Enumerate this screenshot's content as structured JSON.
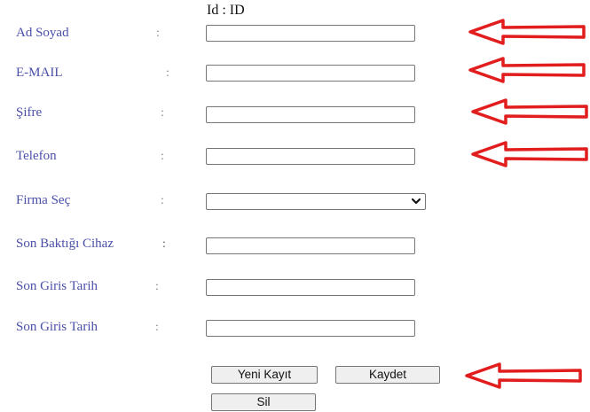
{
  "form": {
    "id_line": "Id : ID",
    "fields": [
      {
        "label": "Ad Soyad",
        "colon": ":",
        "value": ""
      },
      {
        "label": "E-MAIL",
        "colon": ":",
        "value": ""
      },
      {
        "label": "Şifre",
        "colon": ":",
        "value": ""
      },
      {
        "label": "Telefon",
        "colon": ":",
        "value": ""
      },
      {
        "label": "Firma Seç",
        "colon": ":",
        "value": ""
      },
      {
        "label": "Son Baktığı Cihaz",
        "colon": ":",
        "value": ""
      },
      {
        "label": "Son Giris Tarih",
        "colon": ":",
        "value": ""
      },
      {
        "label": "Son Giris Tarih",
        "colon": ":",
        "value": ""
      }
    ],
    "buttons": {
      "new_record": "Yeni Kayıt",
      "save": "Kaydet",
      "delete": "Sil"
    }
  },
  "colors": {
    "label": "#4a4fa8",
    "arrow": "#e11d1d",
    "button_bg": "#efefef"
  },
  "icons": {
    "select_chevron": "chevron-down-icon",
    "annotation_arrow": "left-arrow-icon"
  }
}
